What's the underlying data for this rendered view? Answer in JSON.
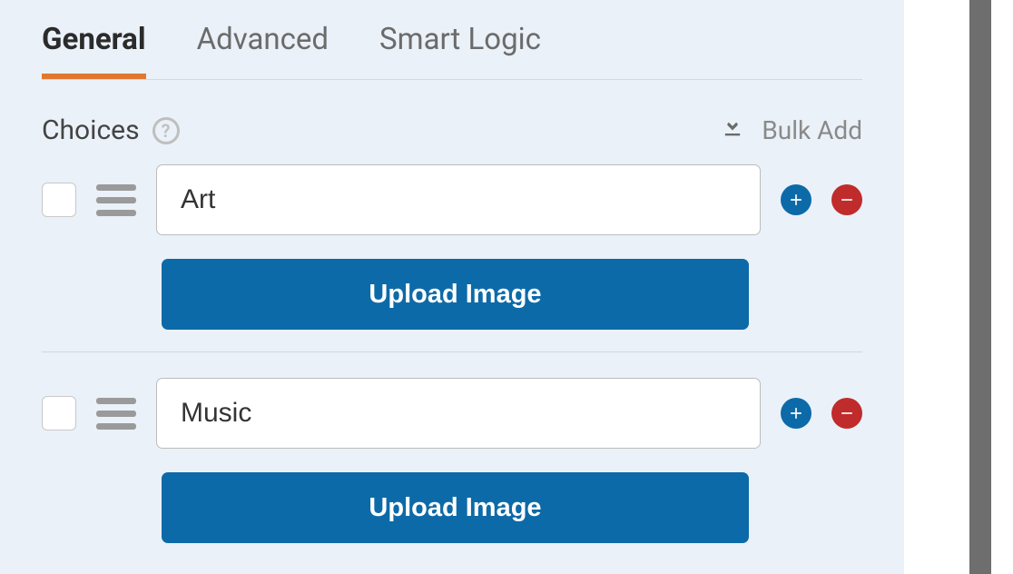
{
  "tabs": {
    "general": "General",
    "advanced": "Advanced",
    "smart_logic": "Smart Logic"
  },
  "section": {
    "label": "Choices",
    "bulk_add": "Bulk Add"
  },
  "choices": [
    {
      "value": "Art",
      "upload_label": "Upload Image"
    },
    {
      "value": "Music",
      "upload_label": "Upload Image"
    }
  ],
  "colors": {
    "active_tab": "#e27730",
    "primary": "#0d6aa8",
    "danger": "#c02b2b"
  }
}
